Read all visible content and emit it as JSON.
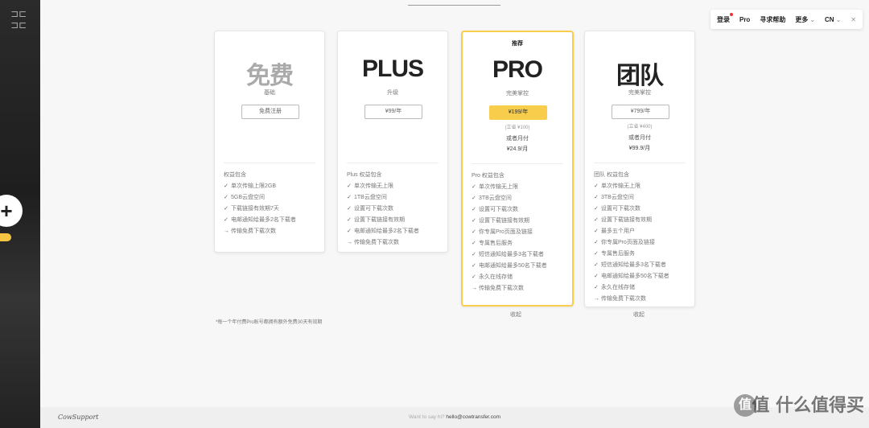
{
  "top_tab": "",
  "nav": {
    "login": "登录",
    "pro": "Pro",
    "help": "寻求帮助",
    "more": "更多",
    "lang": "CN"
  },
  "plans": [
    {
      "name": "免费",
      "sub": "基础",
      "button": "免费注册",
      "features_title": "权益包含",
      "features": [
        "单次传输上限2GB",
        "5GB云盘空间",
        "下载链接有效期7天",
        "电邮通知给最多2名下载者",
        "传输免费下载次数"
      ]
    },
    {
      "name": "PLUS",
      "sub": "升级",
      "button": "¥99/年",
      "features_title": "Plus 权益包含",
      "features": [
        "单次传输无上限",
        "1TB云盘空间",
        "设置可下载次数",
        "设置下载链接有效期",
        "电邮通知给最多2名下载者",
        "传输免费下载次数"
      ]
    },
    {
      "recommend": "推荐",
      "name": "PRO",
      "sub": "完美掌控",
      "button": "¥199/年",
      "orig": "(立省 ¥100)",
      "monthly_label": "或者月付",
      "monthly_price": "¥24.9/月",
      "features_title": "Pro 权益包含",
      "features": [
        "单次传输无上限",
        "3TB云盘空间",
        "设置可下载次数",
        "设置下载链接有效期",
        "你专属Pro页面及链接",
        "专属售后服务",
        "短信通知给最多3名下载者",
        "电邮通知给最多50名下载者",
        "永久在线存储",
        "传输免费下载次数"
      ],
      "collapse": "收起"
    },
    {
      "name": "团队",
      "sub": "完美掌控",
      "button": "¥799/年",
      "orig": "(立省 ¥400)",
      "monthly_label": "或者月付",
      "monthly_price": "¥99.9/月",
      "features_title": "团队 权益包含",
      "features": [
        "单次传输无上限",
        "3TB云盘空间",
        "设置可下载次数",
        "设置下载链接有效期",
        "最多五个用户",
        "你专属Pro页面及链接",
        "专属售后服务",
        "短信通知给最多3名下载者",
        "电邮通知给最多50名下载者",
        "永久在线存储",
        "传输免费下载次数"
      ],
      "collapse": "收起"
    }
  ],
  "footnote": "*每一个年付费Pro账号都拥有额外免费30天有效期",
  "footer": {
    "brand": "CowSupport",
    "contact_prefix": "Want to say hi?",
    "contact_email": "hello@cowtransfer.com"
  },
  "watermark": "值 什么值得买"
}
